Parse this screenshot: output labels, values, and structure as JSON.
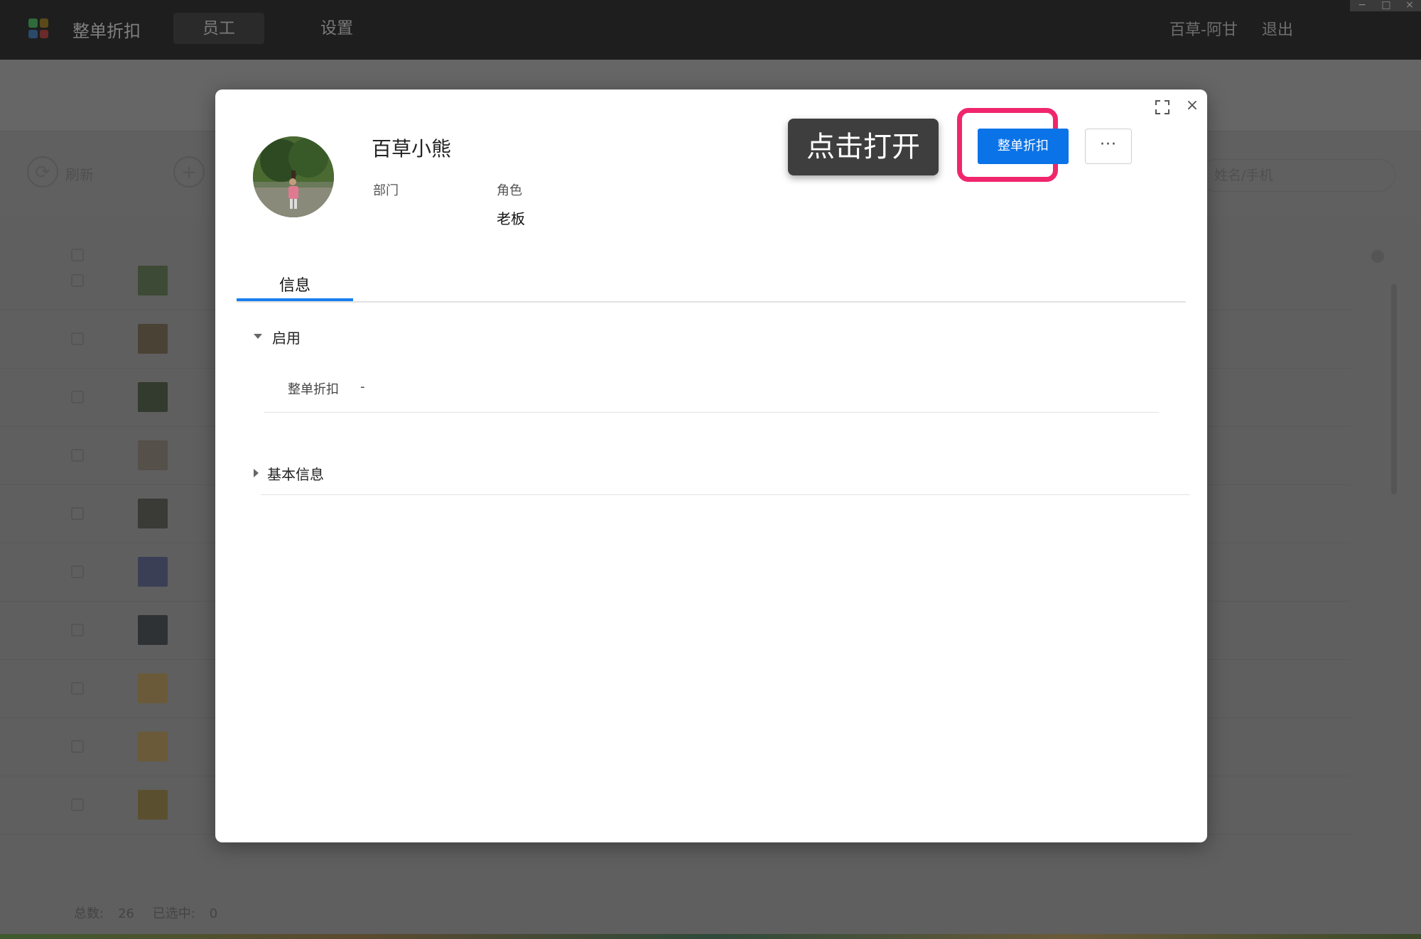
{
  "app": {
    "title": "整单折扣",
    "nav": [
      {
        "label": "员工"
      },
      {
        "label": "设置"
      }
    ],
    "user": "百草-阿甘",
    "logout": "退出",
    "logo_colors": [
      "#2f6a3a",
      "#5a4a1a",
      "#2a4a6a",
      "#6a2a2a"
    ]
  },
  "toolbar": {
    "refresh": "刷新",
    "search_placeholder": "姓名/手机"
  },
  "footer": {
    "total_label": "总数:",
    "total_value": "26",
    "selected_label": "已选中:",
    "selected_value": "0"
  },
  "modal": {
    "profile": {
      "name": "百草小熊",
      "dept_label": "部门",
      "role_label": "角色",
      "role_value": "老板"
    },
    "tooltip": "点击打开",
    "primary_button": "整单折扣",
    "more_button": "···",
    "tabs": [
      {
        "label": "信息"
      }
    ],
    "sections": [
      {
        "title": "启用",
        "expanded": true,
        "fields": [
          {
            "label": "整单折扣",
            "value": "-"
          }
        ]
      },
      {
        "title": "基本信息",
        "expanded": false
      }
    ]
  },
  "colors": {
    "accent": "#0a73e8",
    "highlight": "#f0266d",
    "tab_underline": "#1a7ef0"
  }
}
